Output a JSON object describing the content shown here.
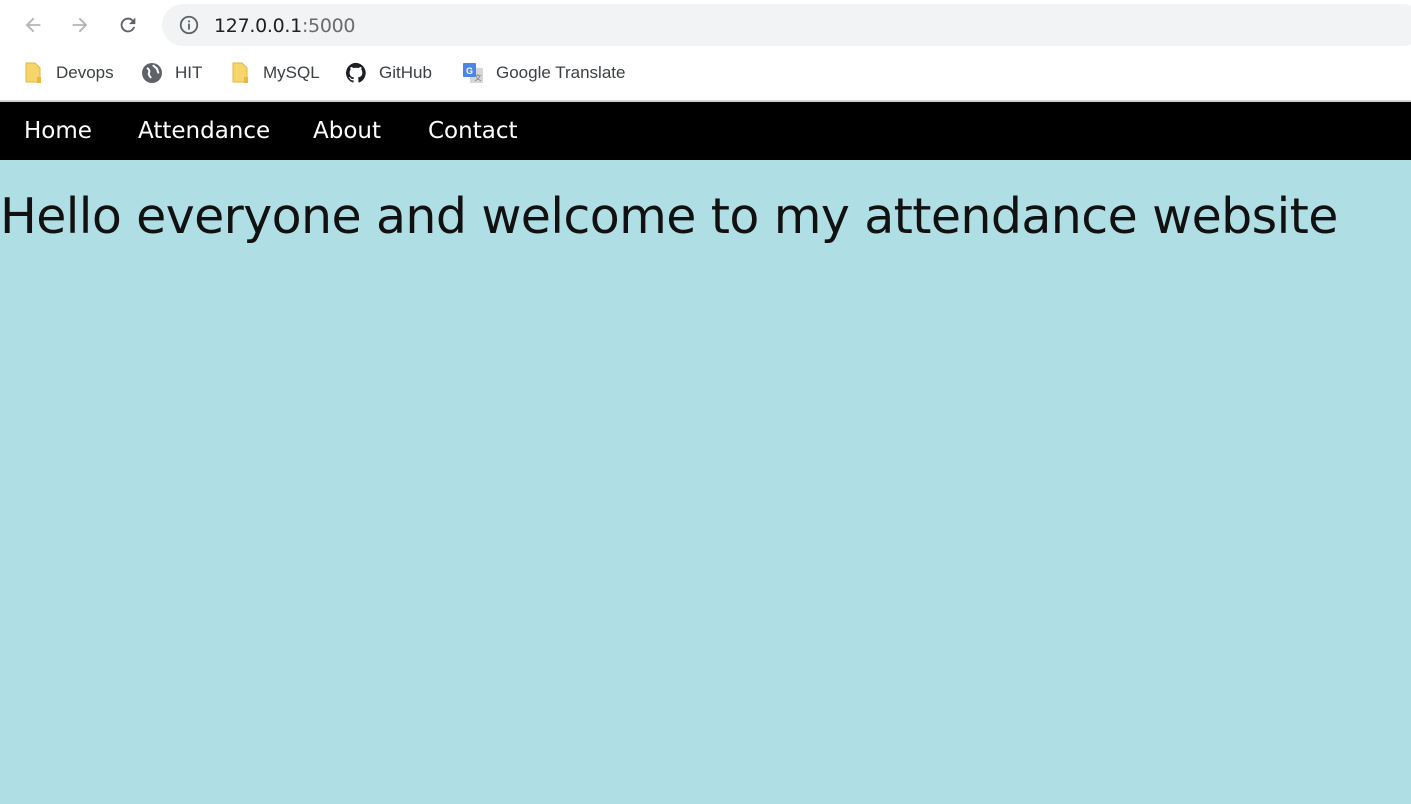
{
  "browser": {
    "url_host": "127.0.0.1",
    "url_port": ":5000",
    "icons": {
      "back": "arrow-left-icon",
      "forward": "arrow-right-icon",
      "reload": "reload-icon",
      "info": "info-icon"
    },
    "bookmarks": [
      {
        "label": "Devops",
        "icon": "folder-icon"
      },
      {
        "label": "HIT",
        "icon": "globe-icon"
      },
      {
        "label": "MySQL",
        "icon": "folder-icon"
      },
      {
        "label": "GitHub",
        "icon": "github-icon"
      },
      {
        "label": "Google Translate",
        "icon": "google-translate-icon"
      }
    ]
  },
  "site": {
    "nav": [
      {
        "label": "Home"
      },
      {
        "label": "Attendance"
      },
      {
        "label": "About"
      },
      {
        "label": "Contact"
      }
    ],
    "heading": "Hello everyone and welcome to my attendance website",
    "colors": {
      "navbar_bg": "#000000",
      "nav_text": "#ffffff",
      "page_bg": "#b0dee5"
    }
  }
}
